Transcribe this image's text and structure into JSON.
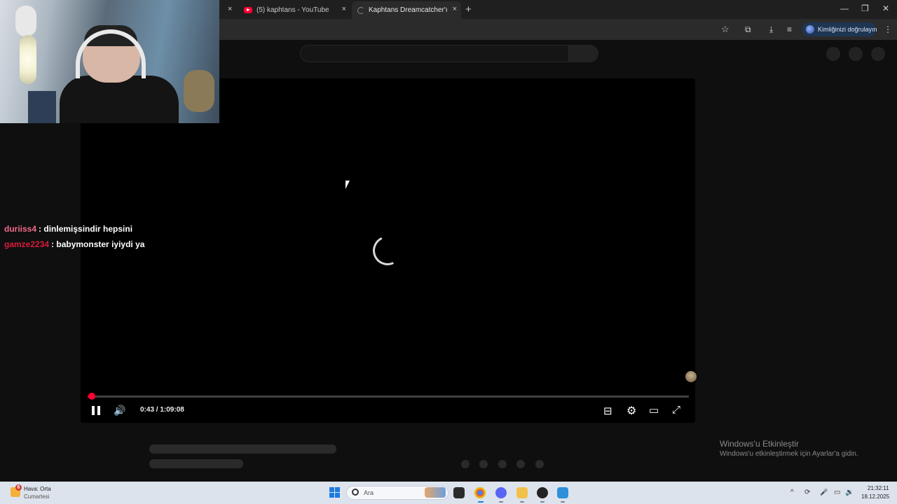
{
  "browser": {
    "tabs": [
      {
        "title": "(5) kaphtans - YouTube",
        "close": "×"
      },
      {
        "title": "Kaphtans Dreamcatcher'ın Büt",
        "close": "×"
      }
    ],
    "partial_tab_close": "×",
    "new_tab": "+",
    "window_controls": {
      "minimize": "—",
      "restore": "❐",
      "close": "✕"
    },
    "toolbar": {
      "star": "☆",
      "extensions": "⧉",
      "download": "⤓",
      "media": "≡",
      "verify_label": "Kimliğinizi doğrulayın",
      "menu": "⋮"
    }
  },
  "player": {
    "time": "0:43 / 1:09:08",
    "progress_percent": 1.0,
    "controls": {
      "subtitles": "⊟",
      "settings": "⚙",
      "theater": "▭",
      "fullscreen": "⤢",
      "volume": "🔊"
    }
  },
  "chat": [
    {
      "user": "duriiss4",
      "message": ": dinlemişsindir hepsini",
      "color": "#f06a8a"
    },
    {
      "user": "gamze2234",
      "message": ": babymonster iyiydi ya",
      "color": "#d81b3c"
    }
  ],
  "watermark": {
    "title": "Windows'u Etkinleştir",
    "subtitle": "Windows'u etkinleştirmek için Ayarlar'a gidin."
  },
  "taskbar": {
    "weather": {
      "badge": "6",
      "line1": "Hava: Orta",
      "line2": "Cumartesi"
    },
    "search_label": "Ara",
    "tray": {
      "chevron": "^",
      "sync": "⟳",
      "mic": "🎤",
      "display": "▭",
      "volume": "🔉"
    },
    "clock": {
      "time": "21:32:11",
      "date": "18.12.2025"
    }
  },
  "colors": {
    "accent_red": "#ff0033",
    "verify_bg": "#1e3553"
  }
}
